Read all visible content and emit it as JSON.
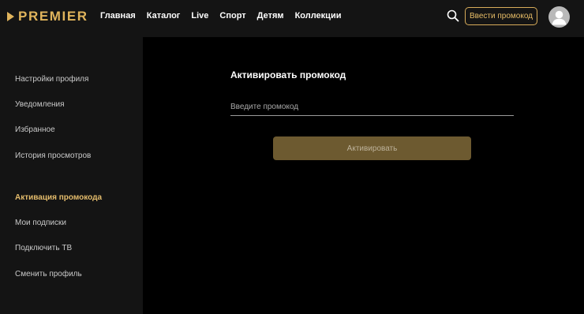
{
  "header": {
    "logo_text": "PREMIER",
    "nav": [
      {
        "label": "Главная"
      },
      {
        "label": "Каталог"
      },
      {
        "label": "Live"
      },
      {
        "label": "Спорт"
      },
      {
        "label": "Детям"
      },
      {
        "label": "Коллекции"
      }
    ],
    "search_icon": "search-icon",
    "promo_button_label": "Ввести промокод",
    "avatar_icon": "user-avatar-icon"
  },
  "sidebar": {
    "items": [
      {
        "label": "Настройки профиля",
        "active": false
      },
      {
        "label": "Уведомления",
        "active": false
      },
      {
        "label": "Избранное",
        "active": false
      },
      {
        "label": "История просмотров",
        "active": false
      },
      {
        "label": "Активация промокода",
        "active": true
      },
      {
        "label": "Мои подписки",
        "active": false
      },
      {
        "label": "Подключить ТВ",
        "active": false
      },
      {
        "label": "Сменить профиль",
        "active": false
      }
    ]
  },
  "main": {
    "title": "Активировать промокод",
    "input_value": "",
    "input_placeholder": "Введите промокод",
    "activate_button_label": "Активировать"
  },
  "colors": {
    "accent": "#e0b45c",
    "header_bg": "#141414",
    "sidebar_bg": "#141414",
    "main_bg": "#000000",
    "button_bg": "#6d5a30"
  }
}
